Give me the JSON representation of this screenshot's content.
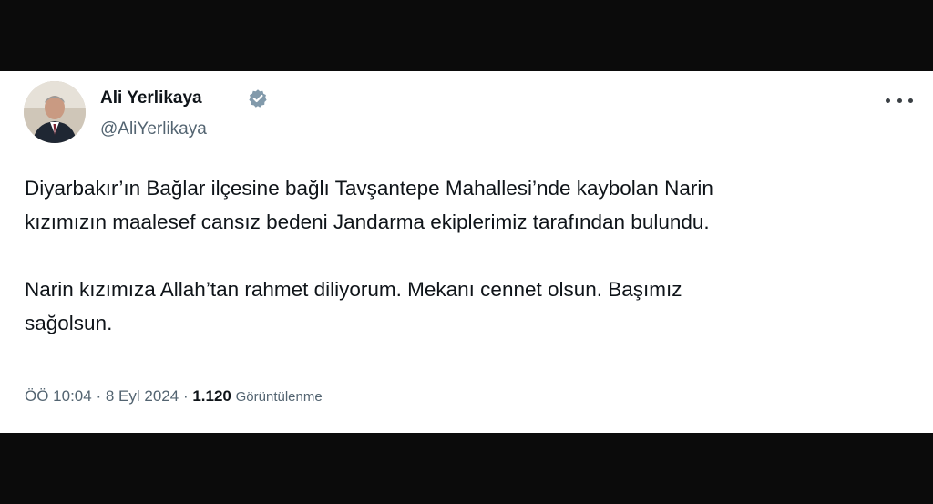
{
  "author": {
    "name": "Ali Yerlikaya",
    "handle": "@AliYerlikaya",
    "verified_icon": "verified-badge-icon",
    "verified_color": "#829aab"
  },
  "tweet": {
    "lines": [
      "Diyarbakır’ın Bağlar ilçesine bağlı Tavşantepe Mahallesi’nde kaybolan Narin",
      "kızımızın maalesef cansız bedeni Jandarma ekiplerimiz tarafından bulundu.",
      "",
      "Narin kızımıza Allah’tan rahmet diliyorum. Mekanı cennet olsun. Başımız",
      "sağolsun."
    ]
  },
  "meta": {
    "time": "ÖÖ 10:04",
    "separator": "·",
    "date": "8 Eyl 2024",
    "views_count": "1.120",
    "views_label": "Görüntülenme"
  },
  "actions": {
    "more_icon": "more-horizontal-icon"
  },
  "colors": {
    "letterbox": "#0b0b0b",
    "card_background": "#ffffff",
    "text_primary": "#0f1419",
    "text_secondary": "#536471"
  }
}
